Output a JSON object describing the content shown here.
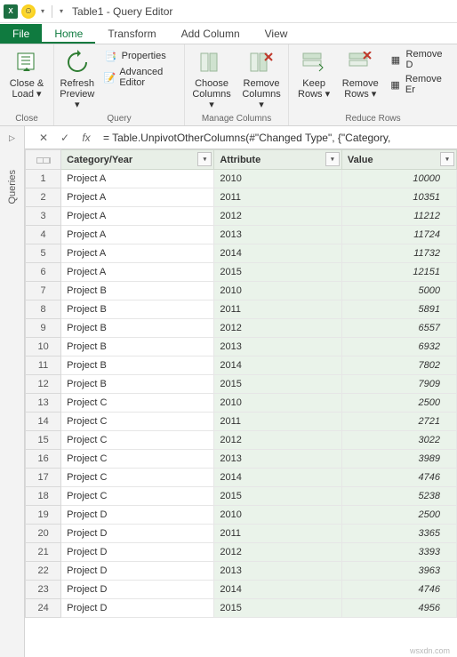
{
  "title": "Table1 - Query Editor",
  "tabs": {
    "file": "File",
    "home": "Home",
    "transform": "Transform",
    "addcol": "Add Column",
    "view": "View"
  },
  "ribbon": {
    "close": {
      "label": "Close &\nLoad ▾",
      "group": "Close"
    },
    "refresh": {
      "label": "Refresh\nPreview ▾",
      "props": "Properties",
      "adv": "Advanced Editor",
      "group": "Query"
    },
    "choosecols": {
      "label": "Choose\nColumns ▾"
    },
    "removecols": {
      "label": "Remove\nColumns ▾",
      "group": "Manage Columns"
    },
    "keeprows": {
      "label": "Keep\nRows ▾"
    },
    "removerows": {
      "label": "Remove\nRows ▾",
      "group": "Reduce Rows"
    },
    "removedup": "Remove D",
    "removeerr": "Remove Er"
  },
  "formula": "= Table.UnpivotOtherColumns(#\"Changed Type\", {\"Category,",
  "fx": "fx",
  "sidebar": "Queries",
  "headers": {
    "cat": "Category/Year",
    "attr": "Attribute",
    "val": "Value"
  },
  "rows": [
    {
      "n": "1",
      "c": "Project A",
      "a": "2010",
      "v": "10000"
    },
    {
      "n": "2",
      "c": "Project A",
      "a": "2011",
      "v": "10351"
    },
    {
      "n": "3",
      "c": "Project A",
      "a": "2012",
      "v": "11212"
    },
    {
      "n": "4",
      "c": "Project A",
      "a": "2013",
      "v": "11724"
    },
    {
      "n": "5",
      "c": "Project A",
      "a": "2014",
      "v": "11732"
    },
    {
      "n": "6",
      "c": "Project A",
      "a": "2015",
      "v": "12151"
    },
    {
      "n": "7",
      "c": "Project B",
      "a": "2010",
      "v": "5000"
    },
    {
      "n": "8",
      "c": "Project B",
      "a": "2011",
      "v": "5891"
    },
    {
      "n": "9",
      "c": "Project B",
      "a": "2012",
      "v": "6557"
    },
    {
      "n": "10",
      "c": "Project B",
      "a": "2013",
      "v": "6932"
    },
    {
      "n": "11",
      "c": "Project B",
      "a": "2014",
      "v": "7802"
    },
    {
      "n": "12",
      "c": "Project B",
      "a": "2015",
      "v": "7909"
    },
    {
      "n": "13",
      "c": "Project C",
      "a": "2010",
      "v": "2500"
    },
    {
      "n": "14",
      "c": "Project C",
      "a": "2011",
      "v": "2721"
    },
    {
      "n": "15",
      "c": "Project C",
      "a": "2012",
      "v": "3022"
    },
    {
      "n": "16",
      "c": "Project C",
      "a": "2013",
      "v": "3989"
    },
    {
      "n": "17",
      "c": "Project C",
      "a": "2014",
      "v": "4746"
    },
    {
      "n": "18",
      "c": "Project C",
      "a": "2015",
      "v": "5238"
    },
    {
      "n": "19",
      "c": "Project D",
      "a": "2010",
      "v": "2500"
    },
    {
      "n": "20",
      "c": "Project D",
      "a": "2011",
      "v": "3365"
    },
    {
      "n": "21",
      "c": "Project D",
      "a": "2012",
      "v": "3393"
    },
    {
      "n": "22",
      "c": "Project D",
      "a": "2013",
      "v": "3963"
    },
    {
      "n": "23",
      "c": "Project D",
      "a": "2014",
      "v": "4746"
    },
    {
      "n": "24",
      "c": "Project D",
      "a": "2015",
      "v": "4956"
    }
  ],
  "watermark": "wsxdn.com"
}
